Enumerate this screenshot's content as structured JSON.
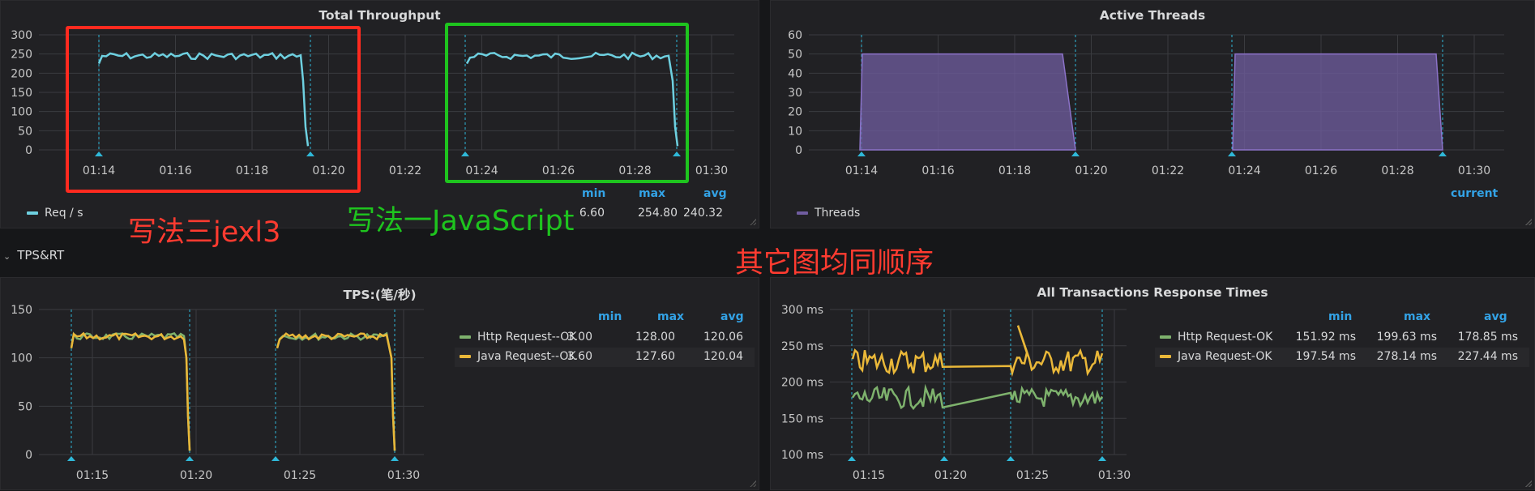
{
  "panels": {
    "throughput": {
      "title": "Total Throughput",
      "y_ticks": [
        "300",
        "250",
        "200",
        "150",
        "100",
        "50",
        "0"
      ],
      "x_ticks": [
        "01:14",
        "01:16",
        "01:18",
        "01:20",
        "01:22",
        "01:24",
        "01:26",
        "01:28",
        "01:30"
      ],
      "legend": {
        "label": "Req / s",
        "color": "#6ed0e0",
        "hdr_min": "min",
        "hdr_max": "max",
        "hdr_avg": "avg",
        "min": "6.60",
        "max": "254.80",
        "avg": "240.32"
      }
    },
    "threads": {
      "title": "Active Threads",
      "y_ticks": [
        "60",
        "50",
        "40",
        "30",
        "20",
        "10",
        "0"
      ],
      "x_ticks": [
        "01:14",
        "01:16",
        "01:18",
        "01:20",
        "01:22",
        "01:24",
        "01:26",
        "01:28",
        "01:30"
      ],
      "legend": {
        "label": "Threads",
        "color": "#705da0",
        "hdr_current": "current"
      }
    },
    "tps": {
      "title": "TPS:(笔/秒)",
      "y_ticks": [
        "150",
        "100",
        "50",
        "0"
      ],
      "x_ticks": [
        "01:15",
        "01:20",
        "01:25",
        "01:30"
      ],
      "legend": {
        "hdr_min": "min",
        "hdr_max": "max",
        "hdr_avg": "avg",
        "rows": [
          {
            "label": "Http Request--OK",
            "color": "#7eb26d",
            "min": "3.00",
            "max": "128.00",
            "avg": "120.06"
          },
          {
            "label": "Java Request--OK",
            "color": "#eab839",
            "min": "3.60",
            "max": "127.60",
            "avg": "120.04"
          }
        ]
      }
    },
    "rt": {
      "title": "All Transactions Response Times",
      "y_ticks": [
        "300 ms",
        "250 ms",
        "200 ms",
        "150 ms",
        "100 ms"
      ],
      "x_ticks": [
        "01:15",
        "01:20",
        "01:25",
        "01:30"
      ],
      "legend": {
        "hdr_min": "min",
        "hdr_max": "max",
        "hdr_avg": "avg",
        "rows": [
          {
            "label": "Http Request-OK",
            "color": "#7eb26d",
            "min": "151.92 ms",
            "max": "199.63 ms",
            "avg": "178.85 ms"
          },
          {
            "label": "Java Request-OK",
            "color": "#eab839",
            "min": "197.54 ms",
            "max": "278.14 ms",
            "avg": "227.44 ms"
          }
        ]
      }
    }
  },
  "row": {
    "title": "TPS&RT"
  },
  "annotations": {
    "jexl3": {
      "text": "写法三jexl3",
      "color": "#ff3b30"
    },
    "javascript": {
      "text": "写法一JavaScript",
      "color": "#1ec41e"
    },
    "order": {
      "text": "其它图均同顺序",
      "color": "#ff3b30"
    }
  },
  "chart_data": [
    {
      "type": "line",
      "title": "Total Throughput",
      "x": [
        "01:14",
        "01:16",
        "01:18",
        "01:20",
        "01:22",
        "01:24",
        "01:26",
        "01:28",
        "01:30"
      ],
      "ylim": [
        0,
        300
      ],
      "series": [
        {
          "name": "Req / s",
          "segments": [
            {
              "start": "01:14",
              "end": "01:19:30",
              "level": 245
            },
            {
              "start": "01:23:50",
              "end": "01:29:30",
              "level": 245
            }
          ],
          "min": 6.6,
          "max": 254.8,
          "avg": 240.32
        }
      ]
    },
    {
      "type": "area",
      "title": "Active Threads",
      "ylim": [
        0,
        60
      ],
      "series": [
        {
          "name": "Threads",
          "segments": [
            {
              "start": "01:14",
              "end": "01:19:30",
              "level": 50
            },
            {
              "start": "01:23:50",
              "end": "01:29:30",
              "level": 50
            }
          ]
        }
      ]
    },
    {
      "type": "line",
      "title": "TPS:(笔/秒)",
      "ylim": [
        0,
        150
      ],
      "series": [
        {
          "name": "Http Request--OK",
          "min": 3.0,
          "max": 128.0,
          "avg": 120.06
        },
        {
          "name": "Java Request--OK",
          "min": 3.6,
          "max": 127.6,
          "avg": 120.04
        }
      ]
    },
    {
      "type": "line",
      "title": "All Transactions Response Times",
      "ylim": [
        100,
        300
      ],
      "series": [
        {
          "name": "Http Request-OK",
          "min": 151.92,
          "max": 199.63,
          "avg": 178.85
        },
        {
          "name": "Java Request-OK",
          "min": 197.54,
          "max": 278.14,
          "avg": 227.44
        }
      ]
    }
  ]
}
